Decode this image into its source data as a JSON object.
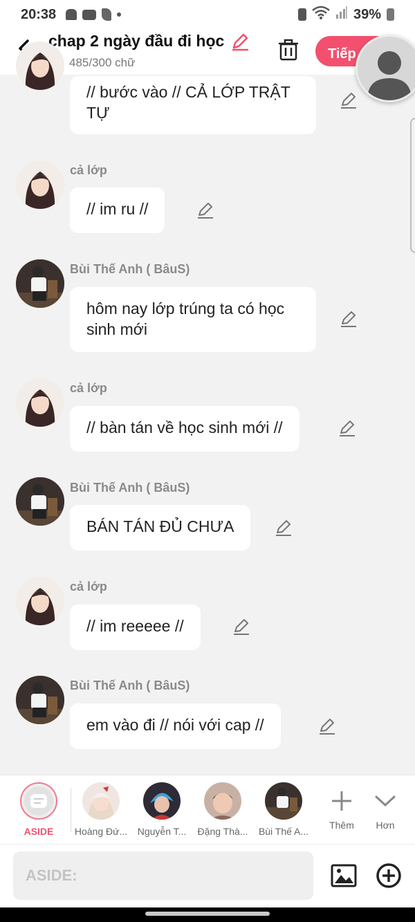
{
  "status_bar": {
    "time": "20:38",
    "battery": "39%"
  },
  "header": {
    "title": "chap 2 ngày đầu đi học",
    "word_count": "485/300 chữ",
    "next_label": "Tiếp",
    "accent": "#f2506e"
  },
  "messages": [
    {
      "speaker": "",
      "text": "// bước vào // CẢ LỚP TRẬT TỰ",
      "avatar": "girl"
    },
    {
      "speaker": "cả lớp",
      "text": "// im ru //",
      "avatar": "girl"
    },
    {
      "speaker": "Bùi Thế Anh ( BâuS)",
      "text": "hôm nay lớp trúng ta có học sinh mới",
      "avatar": "man"
    },
    {
      "speaker": "cả lớp",
      "text": "// bàn tán về học sinh mới //",
      "avatar": "girl"
    },
    {
      "speaker": "Bùi Thế Anh ( BâuS)",
      "text": "BÁN TÁN ĐỦ CHƯA",
      "avatar": "man"
    },
    {
      "speaker": "cả lớp",
      "text": "// im reeeee //",
      "avatar": "girl"
    },
    {
      "speaker": "Bùi Thế Anh ( BâuS)",
      "text": "em vào đi // nói với cap //",
      "avatar": "man"
    }
  ],
  "characters": [
    {
      "label": "ASIDE"
    },
    {
      "label": "Hoàng Đứ..."
    },
    {
      "label": "Nguyễn T..."
    },
    {
      "label": "Đặng Thà..."
    },
    {
      "label": "Bùi Thế A..."
    }
  ],
  "char_actions": {
    "more": "Thêm",
    "collapse": "Hơn"
  },
  "input": {
    "placeholder": "ASIDE:"
  }
}
